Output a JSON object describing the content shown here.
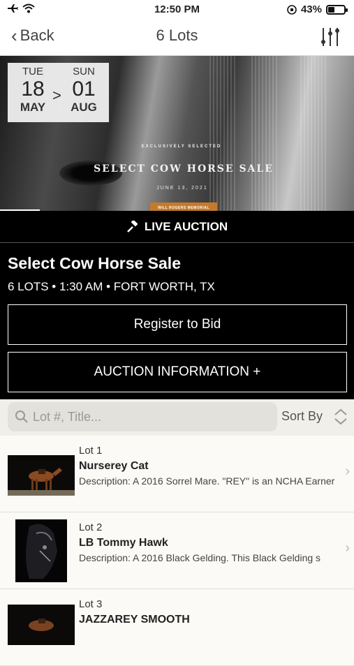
{
  "status_bar": {
    "time": "12:50 PM",
    "battery_percent": "43%",
    "battery_level": 0.43
  },
  "nav": {
    "back_label": "Back",
    "title": "6 Lots"
  },
  "hero": {
    "start": {
      "dow": "TUE",
      "day": "18",
      "month": "MAY"
    },
    "separator": ">",
    "end": {
      "dow": "SUN",
      "day": "01",
      "month": "AUG"
    },
    "tagline": "EXCLUSIVELY SELECTED",
    "title": "SELECT COW HORSE SALE",
    "date": "JUNE 13, 2021",
    "badge": "WILL ROGERS MEMORIAL CENTER"
  },
  "auction": {
    "live_label": "LIVE AUCTION",
    "name": "Select Cow Horse Sale",
    "info": "6 LOTS • 1:30 AM • FORT WORTH, TX",
    "register_label": "Register to Bid",
    "info_button_label": "AUCTION INFORMATION +"
  },
  "search": {
    "placeholder": "Lot #, Title...",
    "sort_label": "Sort By"
  },
  "lots": [
    {
      "number": "Lot 1",
      "title": "Nurserey Cat",
      "description": "Description: A 2016 Sorrel Mare. \"REY\" is an NCHA Earner"
    },
    {
      "number": "Lot 2",
      "title": "LB Tommy Hawk",
      "description": "Description: A 2016 Black Gelding. This Black Gelding s"
    },
    {
      "number": "Lot 3",
      "title": "JAZZAREY SMOOTH",
      "description": ""
    }
  ],
  "colors": {
    "accent": "#c47a2c",
    "dark_panel": "#000000",
    "list_bg": "#fbfaf7"
  }
}
